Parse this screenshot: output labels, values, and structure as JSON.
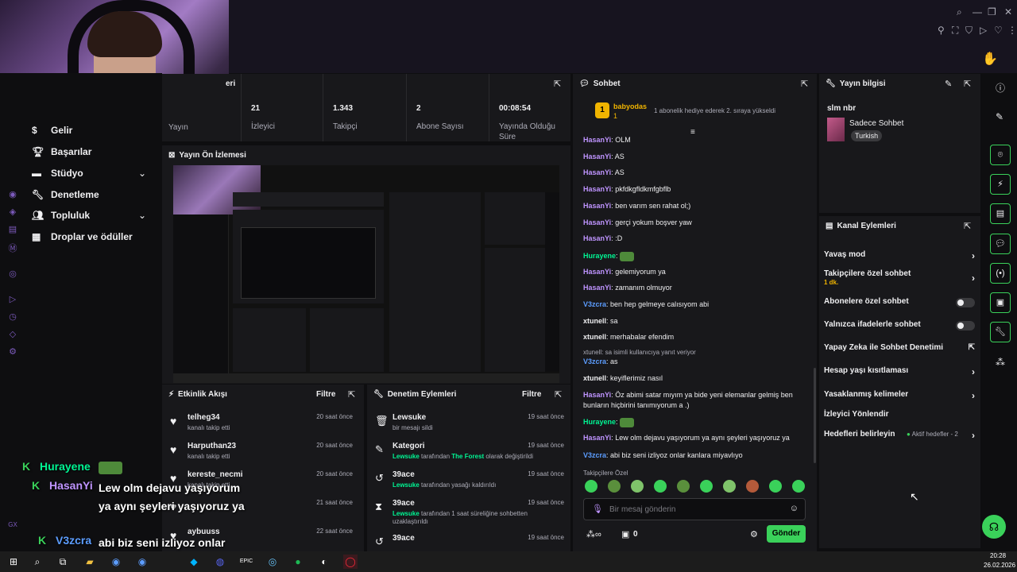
{
  "colors": {
    "accent": "#9147ff",
    "green": "#00f593",
    "panel": "#18181b",
    "bg": "#0e0e10"
  },
  "sidebar": {
    "items": [
      {
        "label": "Gelir",
        "icon": "revenue-icon"
      },
      {
        "label": "Başarılar",
        "icon": "trophy-icon"
      },
      {
        "label": "Stüdyo",
        "icon": "studio-icon",
        "chevron": true
      },
      {
        "label": "Denetleme",
        "icon": "wrench-icon"
      },
      {
        "label": "Topluluk",
        "icon": "community-icon",
        "chevron": true
      },
      {
        "label": "Droplar ve ödüller",
        "icon": "drops-icon"
      }
    ]
  },
  "stats": {
    "header": "Oturum Ayrıntıları",
    "header_visible": "eri",
    "first_label": "Yayın",
    "items": [
      {
        "value": "21",
        "label": "İzleyici"
      },
      {
        "value": "1.343",
        "label": "Takipçi"
      },
      {
        "value": "2",
        "label": "Abone Sayısı"
      },
      {
        "value": "00:08:54",
        "label": "Yayında Olduğu Süre"
      }
    ]
  },
  "preview": {
    "title": "Yayın Ön İzlemesi"
  },
  "activity": {
    "title": "Etkinlik Akışı",
    "filter": "Filtre",
    "items": [
      {
        "name": "telheg34",
        "sub": "kanalı takip etti",
        "time": "20 saat önce"
      },
      {
        "name": "Harputhan23",
        "sub": "kanalı takip etti",
        "time": "20 saat önce"
      },
      {
        "name": "kereste_necmi",
        "sub": "kanalı takip etti",
        "time": "20 saat önce"
      },
      {
        "name": "",
        "sub": "",
        "time": "21 saat önce"
      },
      {
        "name": "aybuuss",
        "sub": "",
        "time": "22 saat önce"
      }
    ]
  },
  "modlog": {
    "title": "Denetim Eylemleri",
    "filter": "Filtre",
    "items": [
      {
        "icon": "trash-icon",
        "name": "Lewsuke",
        "sub": "bir mesajı sildi",
        "time": "19 saat önce"
      },
      {
        "icon": "pencil-icon",
        "name": "Kategori",
        "sub_user": "Lewsuke",
        "sub_mid": " tarafından ",
        "sub_hl": "The Forest",
        "sub_end": " olarak değiştirildi",
        "time": "19 saat önce"
      },
      {
        "icon": "undo-icon",
        "name": "39ace",
        "sub_user": "Lewsuke",
        "sub_end": " tarafından yasağı kaldırıldı",
        "time": "19 saat önce"
      },
      {
        "icon": "hourglass-icon",
        "name": "39ace",
        "sub_user": "Lewsuke",
        "sub_end": " tarafından 1 saat süreliğine sohbetten uzaklaştırıldı",
        "time": "19 saat önce"
      },
      {
        "icon": "undo-icon",
        "name": "39ace",
        "sub": "",
        "time": "19 saat önce"
      }
    ]
  },
  "chat": {
    "title": "Sohbet",
    "pinned_user": "babyodas",
    "pinned_count": "1",
    "pinned_text": "1 abonelik hediye ederek 2. sıraya yükseldi",
    "messages": [
      {
        "user": "HasanYi",
        "color": "#bf94ff",
        "text": "OLM"
      },
      {
        "user": "HasanYi",
        "color": "#bf94ff",
        "text": "AS"
      },
      {
        "user": "HasanYi",
        "color": "#bf94ff",
        "text": "AS"
      },
      {
        "user": "HasanYi",
        "color": "#bf94ff",
        "text": "pkfdkgfldkmfgbflb"
      },
      {
        "user": "HasanYi",
        "color": "#bf94ff",
        "text": "ben varım sen rahat ol;)"
      },
      {
        "user": "HasanYi",
        "color": "#bf94ff",
        "text": "gerçi yokum boşver yaw"
      },
      {
        "user": "HasanYi",
        "color": "#bf94ff",
        "text": ":D"
      },
      {
        "user": "Hurayene",
        "color": "#00f593",
        "text": "",
        "emote": true
      },
      {
        "user": "HasanYi",
        "color": "#bf94ff",
        "text": "gelemiyorum ya"
      },
      {
        "user": "HasanYi",
        "color": "#bf94ff",
        "text": "zamanım olmuyor"
      },
      {
        "user": "V3zcra",
        "color": "#5c9dff",
        "text": "ben hep gelmeye calısıyom abi"
      },
      {
        "user": "xtunell",
        "color": "#efeff1",
        "text": "sa"
      },
      {
        "user": "xtunell",
        "color": "#efeff1",
        "text": "merhabalar efendim"
      },
      {
        "reply": "xtunell: sa isimli kullanıcıya yanıt veriyor",
        "user": "V3zcra",
        "color": "#5c9dff",
        "text": "as"
      },
      {
        "user": "xtunell",
        "color": "#efeff1",
        "text": "keyiflerimiz nasıl"
      },
      {
        "user": "HasanYi",
        "color": "#bf94ff",
        "text": "Öz abimi satar mıyım ya bide yeni elemanlar gelmiş ben bunların hiçbirini tanımıyorum a .)"
      },
      {
        "user": "Hurayene",
        "color": "#00f593",
        "text": "",
        "emote": true
      },
      {
        "user": "HasanYi",
        "color": "#bf94ff",
        "text": "Lew olm dejavu yaşıyorum ya aynı şeyleri yaşıyoruz ya"
      },
      {
        "user": "V3zcra",
        "color": "#5c9dff",
        "text": "abi biz seni izliyoz onlar kanlara miyavlıyo"
      }
    ],
    "follower_emotes": "Takipçilere Özel",
    "input_placeholder": "Bir mesaj gönderin",
    "points": "0",
    "send": "Gönder"
  },
  "streaminfo": {
    "title": "Yayın bilgisi",
    "stream_title": "slm nbr",
    "category": "Sadece Sohbet",
    "language": "Turkish"
  },
  "actions": {
    "title": "Kanal Eylemleri",
    "items": [
      {
        "label": "Yavaş mod",
        "type": "chev"
      },
      {
        "label": "Takipçilere özel sohbet",
        "sub": "1 dk.",
        "type": "chev"
      },
      {
        "label": "Abonelere özel sohbet",
        "type": "toggle"
      },
      {
        "label": "Yalnızca ifadelerle sohbet",
        "type": "toggle"
      },
      {
        "label": "Yapay Zeka ile Sohbet Denetimi",
        "type": "ext"
      },
      {
        "label": "Hesap yaşı kısıtlaması",
        "type": "chev"
      },
      {
        "label": "Yasaklanmış kelimeler",
        "type": "chev"
      },
      {
        "label": "İzleyici Yönlendir",
        "type": "none"
      },
      {
        "label": "Hedefleri belirleyin",
        "extra": "Aktif hedefler - 2",
        "type": "chev"
      }
    ]
  },
  "overlay": [
    {
      "user": "Hurayene",
      "color": "#00f593",
      "text": ""
    },
    {
      "user": "HasanYi",
      "color": "#bf94ff",
      "text": "Lew olm dejavu yaşıyorum ya aynı şeyleri yaşıyoruz ya"
    },
    {
      "user": "V3zcra",
      "color": "#5c9dff",
      "text": "abi biz seni izliyoz onlar kanlara miyavlıyo"
    }
  ],
  "taskbar": {
    "time": "20:28",
    "date": "26.02.2026"
  },
  "rail_label": "GX"
}
